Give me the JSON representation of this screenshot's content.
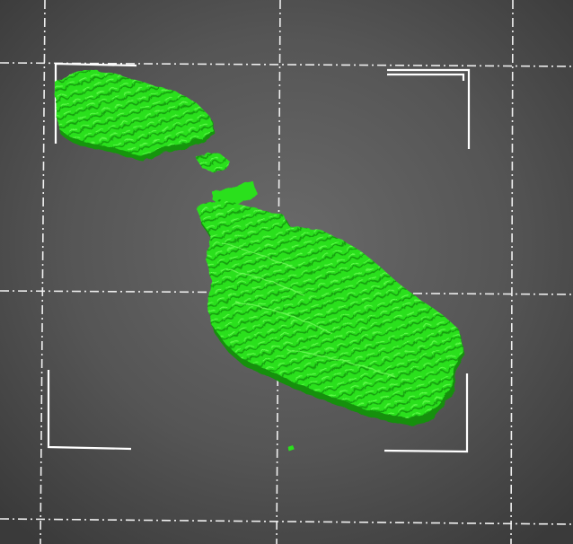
{
  "viewport": {
    "background_center": "#656565",
    "background_edge": "#3e3e3e",
    "grid_color": "#f2f2f2",
    "frame_color": "#ffffff"
  },
  "model": {
    "island_gozo": "gozo-island",
    "island_comino": "comino-island",
    "island_malta": "malta-island",
    "fill_color": "#25e51a",
    "shade_color": "#19a012",
    "highlight_color": "#6cff52"
  }
}
